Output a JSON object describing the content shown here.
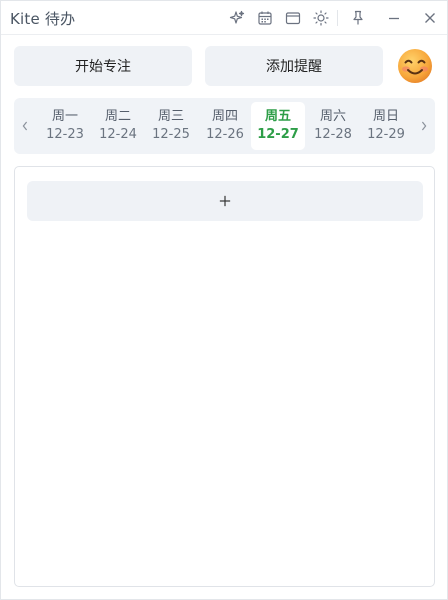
{
  "app": {
    "title": "Kite 待办"
  },
  "titlebar": {
    "icons": [
      "sparkle-icon",
      "calendar-icon",
      "window-icon",
      "theme-sun-icon",
      "pin-icon",
      "minimize-icon",
      "close-icon"
    ]
  },
  "actions": {
    "focus_label": "开始专注",
    "reminder_label": "添加提醒",
    "avatar": "smiling-face-emoji"
  },
  "week": {
    "days": [
      {
        "name": "周一",
        "date": "12-23",
        "active": false
      },
      {
        "name": "周二",
        "date": "12-24",
        "active": false
      },
      {
        "name": "周三",
        "date": "12-25",
        "active": false
      },
      {
        "name": "周四",
        "date": "12-26",
        "active": false
      },
      {
        "name": "周五",
        "date": "12-27",
        "active": true
      },
      {
        "name": "周六",
        "date": "12-28",
        "active": false
      },
      {
        "name": "周日",
        "date": "12-29",
        "active": false
      }
    ]
  },
  "tasks": {
    "add_icon": "plus-icon",
    "items": []
  },
  "colors": {
    "accent_green": "#2e9e48",
    "button_bg": "#eff2f6",
    "icon_gray": "#6b7280"
  }
}
